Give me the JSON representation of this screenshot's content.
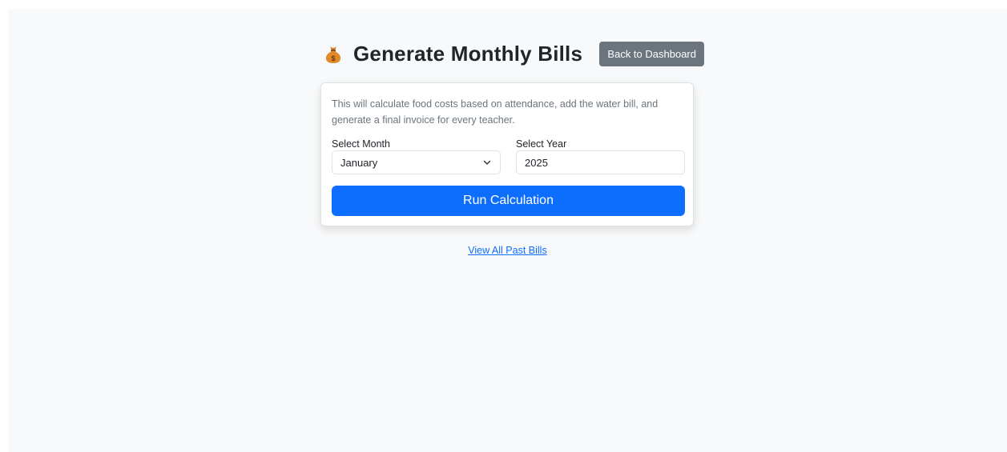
{
  "header": {
    "icon": "moneybag-icon",
    "title": "Generate Monthly Bills",
    "back_button_label": "Back to Dashboard"
  },
  "card": {
    "description": "This will calculate food costs based on attendance, add the water bill, and generate a final invoice for every teacher.",
    "month_label": "Select Month",
    "month_value": "January",
    "year_label": "Select Year",
    "year_value": "2025",
    "submit_label": "Run Calculation"
  },
  "footer": {
    "link_label": "View All Past Bills"
  },
  "colors": {
    "primary": "#0d6efd",
    "secondary": "#6c757d",
    "background": "#f8f9fa"
  }
}
